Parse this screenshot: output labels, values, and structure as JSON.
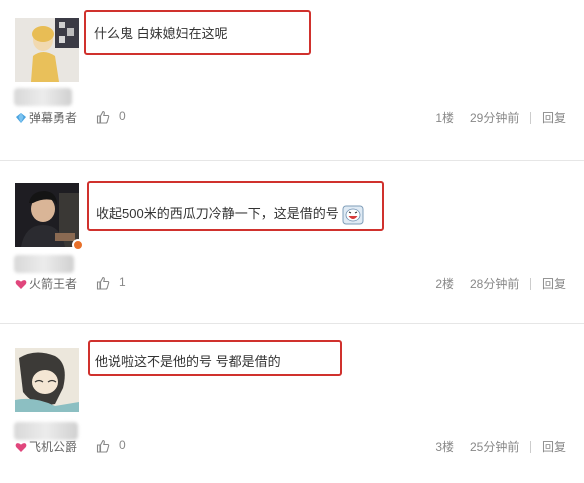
{
  "comments": [
    {
      "username": "弹幕勇者",
      "text": "什么鬼 白妹媳妇在这呢",
      "likes": "0",
      "floor": "1楼",
      "time": "29分钟前",
      "reply": "回复",
      "avatar": "person-yellow-hoodie",
      "user_icon": "diamond-icon",
      "has_emoji": false
    },
    {
      "username": "火箭王者",
      "text": "收起500米的西瓜刀冷静一下，这是借的号",
      "likes": "1",
      "floor": "2楼",
      "time": "28分钟前",
      "reply": "回复",
      "avatar": "person-dark-photo",
      "user_icon": "heart-icon",
      "has_emoji": true,
      "emoji": "laughing-emoji-icon"
    },
    {
      "username": "飞机公爵",
      "text": "他说啦这不是他的号 号都是借的",
      "likes": "0",
      "floor": "3楼",
      "time": "25分钟前",
      "reply": "回复",
      "avatar": "anime-girl-drawing",
      "user_icon": "heart-icon",
      "has_emoji": false
    }
  ],
  "colors": {
    "highlight_border": "#d0312d",
    "meta_text": "#888888",
    "divider": "#e6e6e6"
  }
}
